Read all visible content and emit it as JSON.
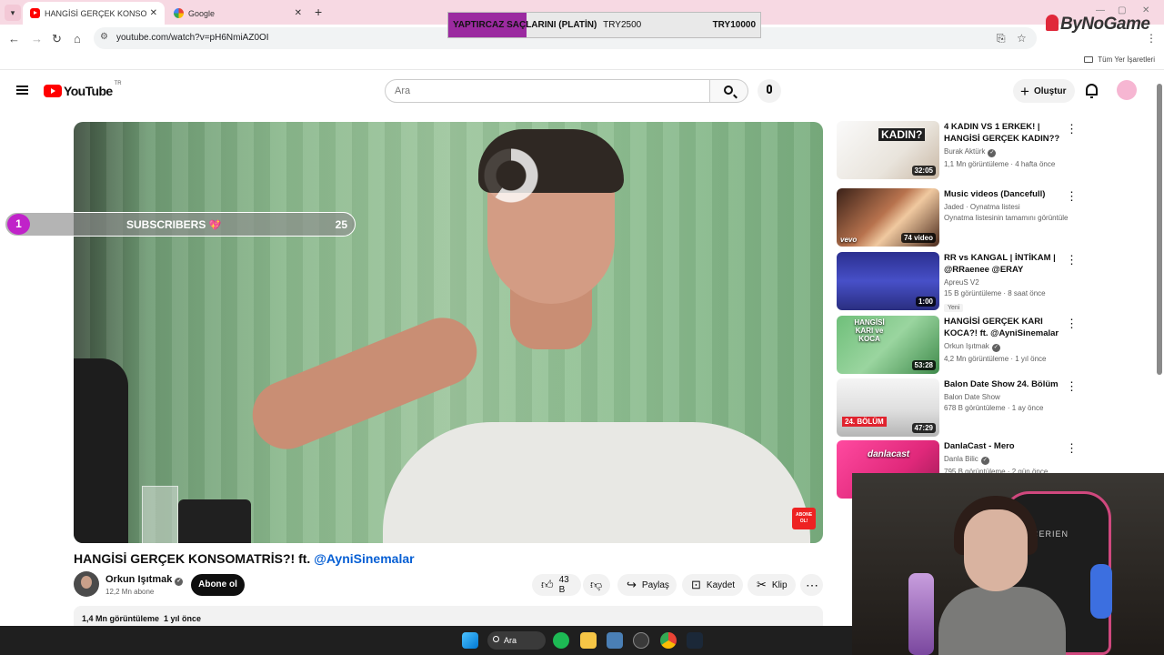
{
  "browser": {
    "tabs": [
      {
        "title": "HANGİSİ GERÇEK KONSOMATR",
        "active": true,
        "icon": "youtube-icon"
      },
      {
        "title": "Google",
        "active": false,
        "icon": "google-icon"
      }
    ],
    "url": "youtube.com/watch?v=pH6NmiAZ0OI",
    "bookmarks_label": "Tüm Yer İşaretleri"
  },
  "donation_bar": {
    "goal": "YAPTIRCAZ SAÇLARINI (PLATİN)",
    "current": "TRY2500",
    "target": "TRY10000",
    "progress": 0.25,
    "color": "#9b2aa0"
  },
  "watermark": "ByNoGame",
  "youtube": {
    "logo": "YouTube",
    "region": "TR",
    "search_placeholder": "Ara",
    "create_label": "Oluştur"
  },
  "subs_overlay": {
    "count": "1",
    "label": "SUBSCRIBERS",
    "goal": "25"
  },
  "video": {
    "title_main": "HANGİSİ GERÇEK KONSOMATRİS?! ft.",
    "title_mention": "@AyniSinemalar",
    "channel": "Orkun Işıtmak",
    "subscribers": "12,2 Mn abone",
    "subscribe_label": "Abone ol",
    "likes": "43 B",
    "share_label": "Paylaş",
    "save_label": "Kaydet",
    "clip_label": "Klip",
    "views": "1,4 Mn görüntüleme",
    "age": "1 yıl önce",
    "overlay_badge": "ABONE OL!"
  },
  "recommendations": [
    {
      "title": "4 KADIN VS 1 ERKEK! | HANGİSİ GERÇEK KADIN??",
      "channel": "Burak Aktürk",
      "meta": "1,1 Mn görüntüleme · 4 hafta önce",
      "duration": "32:05",
      "thumb_text": "KADIN?",
      "thumb_color": "#ffffff"
    },
    {
      "title": "Music videos (Dancefull)",
      "channel": "Jaded · Oynatma listesi",
      "meta": "Oynatma listesinin tamamını görüntüle",
      "duration": "74 video",
      "thumb_text": "vevo",
      "thumb_color": "#6b3b2a"
    },
    {
      "title": "RR vs KANGAL | İNTİKAM | @RRaenee @ERAY",
      "channel": "ApreuS V2",
      "meta": "15 B görüntüleme · 8 saat önce",
      "badge": "Yeni",
      "duration": "1:00",
      "thumb_color": "#3a3fa8"
    },
    {
      "title": "HANGİSİ GERÇEK KARI KOCA?! ft. @AyniSinemalar",
      "channel": "Orkun Işıtmak",
      "meta": "4,2 Mn görüntüleme · 1 yıl önce",
      "duration": "53:28",
      "thumb_text": "HANGİSİ KARI ve KOCA",
      "thumb_color": "#7fc78a"
    },
    {
      "title": "Balon Date Show 24. Bölüm",
      "channel": "Balon Date Show",
      "meta": "678 B görüntüleme · 1 ay önce",
      "duration": "47:29",
      "thumb_text": "24. BÖLÜM",
      "thumb_color": "#f2f2f2"
    },
    {
      "title": "DanlaCast - Mero",
      "channel": "Danla Bilic",
      "meta": "795 B görüntüleme · 2 gün önce",
      "thumb_text": "danlacast",
      "thumb_color": "#e0287a"
    }
  ],
  "webcam": {
    "chair_text": "CERIEN"
  },
  "taskbar": {
    "search_label": "Ara"
  }
}
